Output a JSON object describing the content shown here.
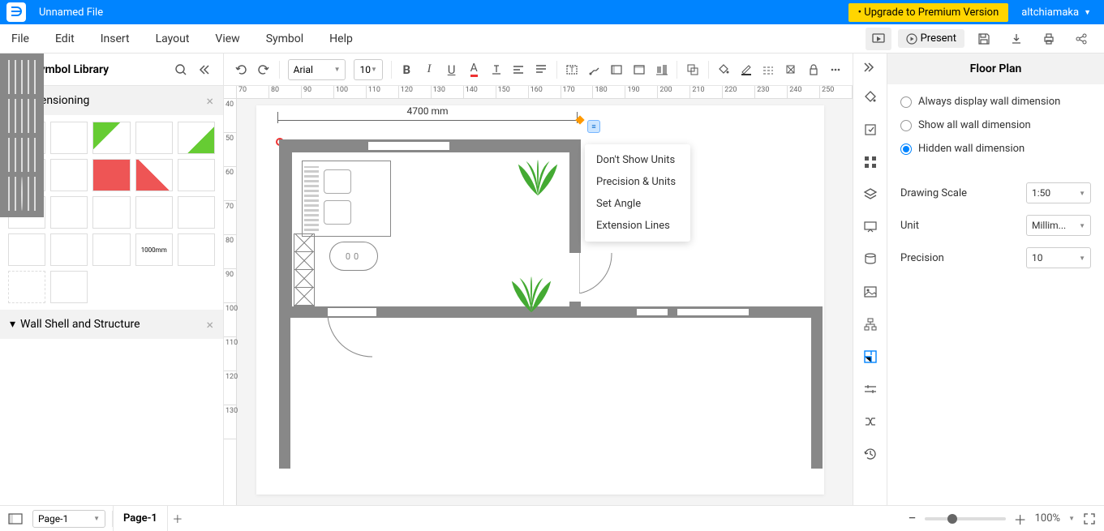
{
  "titlebar": {
    "filename": "Unnamed File",
    "upgrade": "• Upgrade to Premium Version",
    "user": "altchiamaka"
  },
  "menubar": {
    "items": [
      "File",
      "Edit",
      "Insert",
      "Layout",
      "View",
      "Symbol",
      "Help"
    ],
    "present": "Present"
  },
  "toolbar": {
    "font": "Arial",
    "size": "10"
  },
  "sidebar": {
    "title": "Symbol Library",
    "sections": {
      "dimensioning": "Dimensioning",
      "wall": "Wall Shell and Structure"
    }
  },
  "canvas": {
    "dimension_label": "4700 mm",
    "dimension_unit_handle": "≡",
    "mat_text": "00",
    "hruler": [
      "70",
      "80",
      "90",
      "100",
      "110",
      "120",
      "130",
      "140",
      "150",
      "160",
      "170",
      "180",
      "190",
      "200",
      "210",
      "220",
      "230",
      "240",
      "250"
    ],
    "vruler": [
      "40",
      "50",
      "60",
      "70",
      "80",
      "90",
      "100",
      "110",
      "120",
      "130"
    ]
  },
  "context_menu": {
    "items": [
      "Don't Show Units",
      "Precision & Units",
      "Set Angle",
      "Extension Lines"
    ]
  },
  "proppanel": {
    "title": "Floor Plan",
    "radios": [
      "Always display wall dimension",
      "Show all wall dimension",
      "Hidden wall dimension"
    ],
    "selected_radio": 2,
    "drawing_scale_label": "Drawing Scale",
    "drawing_scale_value": "1:50",
    "unit_label": "Unit",
    "unit_value": "Millim...",
    "precision_label": "Precision",
    "precision_value": "10"
  },
  "bottombar": {
    "page_select": "Page-1",
    "tab": "Page-1",
    "zoom": "100%"
  }
}
